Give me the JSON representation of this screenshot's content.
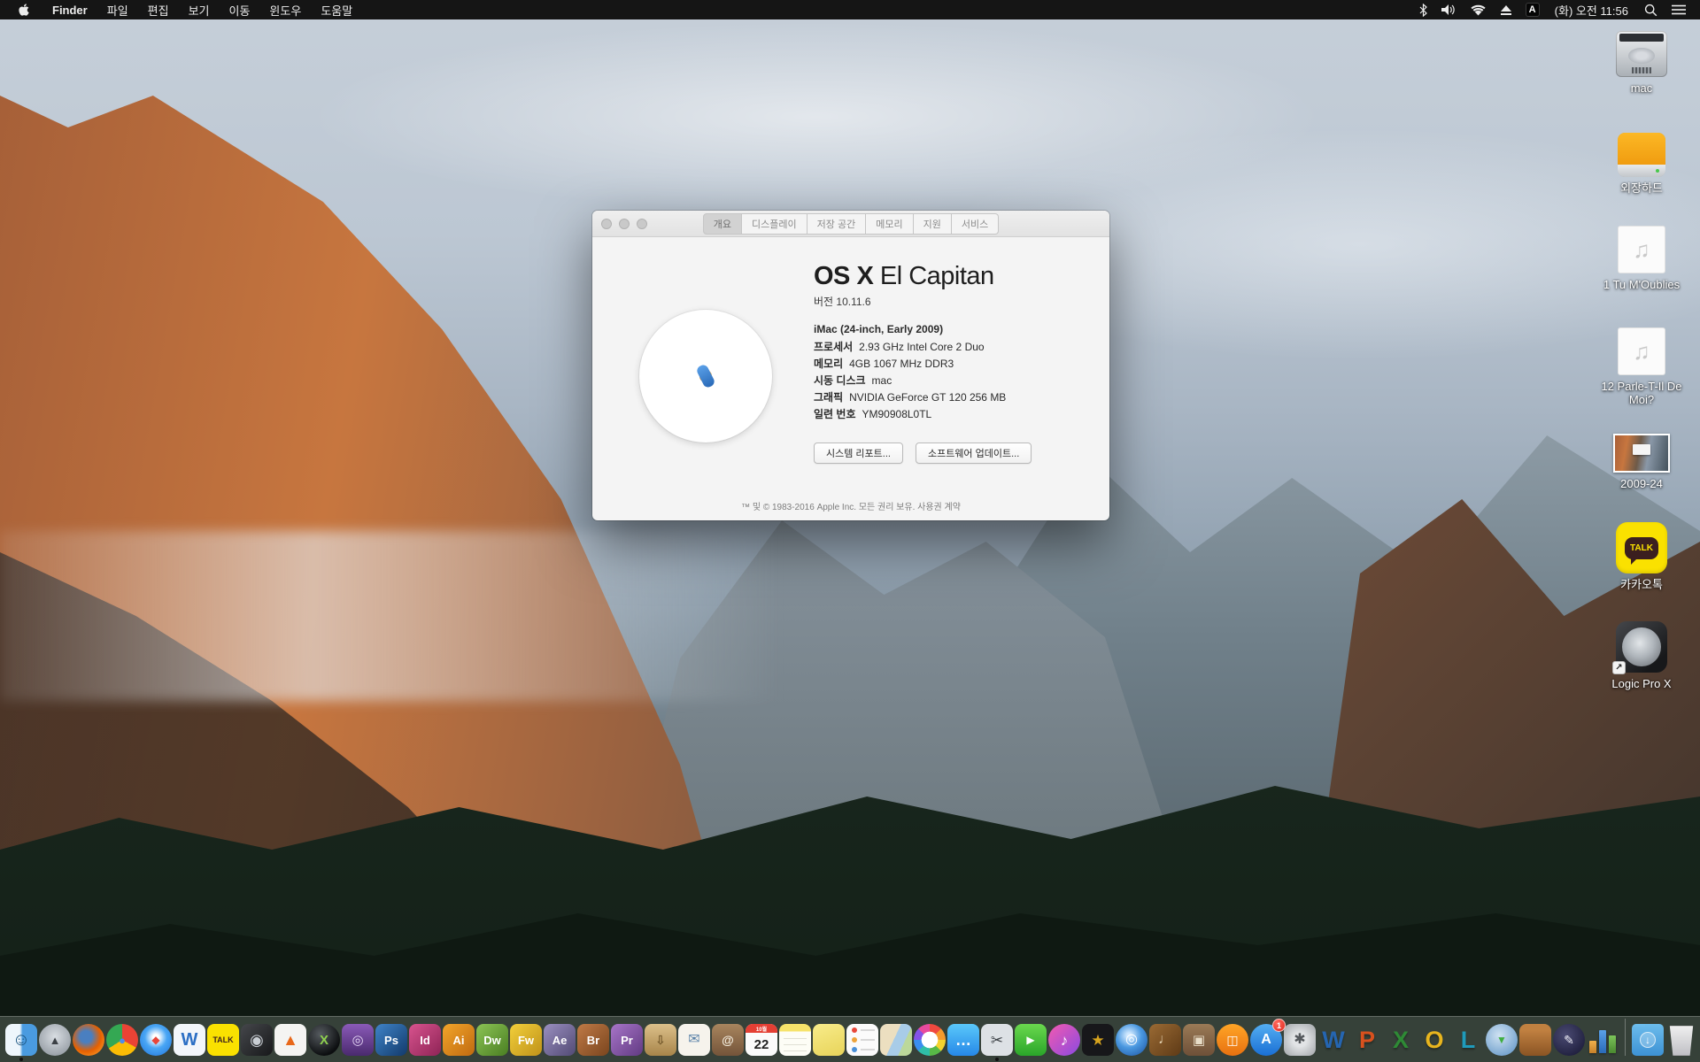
{
  "menu_bar": {
    "items": [
      "Finder",
      "파일",
      "편집",
      "보기",
      "이동",
      "윈도우",
      "도움말"
    ],
    "status": {
      "input_badge": "A",
      "clock": "(화) 오전 11:56"
    }
  },
  "window": {
    "tabs": [
      {
        "label": "개요",
        "selected": true
      },
      {
        "label": "디스플레이",
        "selected": false
      },
      {
        "label": "저장 공간",
        "selected": false
      },
      {
        "label": "메모리",
        "selected": false
      },
      {
        "label": "지원",
        "selected": false
      },
      {
        "label": "서비스",
        "selected": false
      }
    ],
    "title_os": "OS X",
    "title_name": "El Capitan",
    "version": "버전 10.11.6",
    "model": "iMac (24-inch, Early 2009)",
    "specs": [
      {
        "label": "프로세서",
        "value": "2.93 GHz Intel Core 2 Duo"
      },
      {
        "label": "메모리",
        "value": "4GB 1067 MHz DDR3"
      },
      {
        "label": "시동 디스크",
        "value": "mac"
      },
      {
        "label": "그래픽",
        "value": "NVIDIA GeForce GT 120 256 MB"
      },
      {
        "label": "일련 번호",
        "value": "YM90908L0TL"
      }
    ],
    "buttons": [
      "시스템 리포트...",
      "소프트웨어 업데이트..."
    ],
    "footer": "™ 및 © 1983-2016 Apple Inc. 모든 권리 보유. 사용권 계약"
  },
  "desktop_icons": [
    {
      "name": "mac-hdd",
      "label": "mac"
    },
    {
      "name": "external-hdd",
      "label": "외장하드"
    },
    {
      "name": "audio-file-1",
      "label": "1 Tu M'Oublies",
      "glyph": "♫"
    },
    {
      "name": "audio-file-2",
      "label": "12 Parle-T-Il De Moi?",
      "glyph": "♫"
    },
    {
      "name": "image-file",
      "label": "2009-24"
    },
    {
      "name": "kakaotalk",
      "label": "카카오톡",
      "bubble_text": "TALK"
    },
    {
      "name": "logic-pro-alias",
      "label": "Logic Pro X",
      "alias_arrow": "↗"
    }
  ],
  "dock": {
    "items": [
      {
        "name": "finder",
        "glyph": "☺",
        "fg": "#17527e",
        "fs": 20,
        "bg": "linear-gradient(90deg,#eef6fc 46%,#4a9be0 54%)",
        "running": true
      },
      {
        "name": "launchpad",
        "shape": "circle",
        "glyph": "▲",
        "fg": "#3c4146",
        "fs": 13,
        "bg": "radial-gradient(circle at 50% 40%,#d9dee3,#868e96)"
      },
      {
        "name": "firefox",
        "shape": "circle",
        "glyph": "",
        "bg": "radial-gradient(circle at 42% 40%,#4a7fc0 22%,#e66000 55%,#ffb13a)"
      },
      {
        "name": "chrome",
        "shape": "circle",
        "glyph": "●",
        "fg": "#4a8cf0",
        "fs": 13,
        "bg": "conic-gradient(#ea4335 0 33%,#fbbc05 33% 66%,#34a853 66% 100%)"
      },
      {
        "name": "safari",
        "shape": "circle",
        "glyph": "◆",
        "fg": "#e8453a",
        "fs": 12,
        "bg": "radial-gradient(circle at 50% 42%,#ffffff 12%,#49a6f5 45%,#1f72d8)"
      },
      {
        "name": "winebottler",
        "glyph": "W",
        "fg": "#2b6fc4",
        "fs": 20,
        "bold": true,
        "bg": "#f2f6fa"
      },
      {
        "name": "kakaotalk",
        "glyph": "TALK",
        "fg": "#3b1f1f",
        "fs": 9,
        "bold": true,
        "bg": "#fae100"
      },
      {
        "name": "logic-pro",
        "glyph": "◉",
        "fg": "#c9ced4",
        "fs": 18,
        "bg": "linear-gradient(135deg,#45474b,#17181a)"
      },
      {
        "name": "vlc",
        "glyph": "▲",
        "fg": "#e8681a",
        "fs": 18,
        "bg": "#f4f4f2"
      },
      {
        "name": "x-player",
        "shape": "circle",
        "glyph": "X",
        "fg": "#8fd14f",
        "fs": 15,
        "bold": true,
        "bg": "radial-gradient(circle at 38% 32%,#565b60,#0c0e10 72%)"
      },
      {
        "name": "toast-titanium",
        "glyph": "◎",
        "fg": "#e4d4f4",
        "fs": 15,
        "bg": "linear-gradient(180deg,#8a5ab8,#4a2a6e)"
      },
      {
        "name": "photoshop",
        "glyph": "Ps",
        "fg": "#ffffff",
        "fs": 13,
        "bold": true,
        "bg": "linear-gradient(135deg,#3f83c8,#123a6b)"
      },
      {
        "name": "indesign",
        "glyph": "Id",
        "fg": "#ffffff",
        "fs": 13,
        "bold": true,
        "bg": "linear-gradient(135deg,#d8538e,#8e2456)"
      },
      {
        "name": "illustrator",
        "glyph": "Ai",
        "fg": "#ffffff",
        "fs": 13,
        "bold": true,
        "bg": "linear-gradient(135deg,#f2a52a,#c06a10)"
      },
      {
        "name": "dreamweaver",
        "glyph": "Dw",
        "fg": "#ffffff",
        "fs": 13,
        "bold": true,
        "bg": "linear-gradient(135deg,#8cc455,#4a7e22)"
      },
      {
        "name": "fireworks",
        "glyph": "Fw",
        "fg": "#ffffff",
        "fs": 13,
        "bold": true,
        "bg": "linear-gradient(135deg,#f2cf3a,#bf921a)"
      },
      {
        "name": "after-effects",
        "glyph": "Ae",
        "fg": "#ffffff",
        "fs": 13,
        "bold": true,
        "bg": "linear-gradient(135deg,#9a8fc0,#524a74)"
      },
      {
        "name": "bridge",
        "glyph": "Br",
        "fg": "#ffffff",
        "fs": 13,
        "bold": true,
        "bg": "linear-gradient(135deg,#c07a46,#7a451e)"
      },
      {
        "name": "premiere",
        "glyph": "Pr",
        "fg": "#ffffff",
        "fs": 13,
        "bold": true,
        "bg": "linear-gradient(135deg,#a875c8,#613a82)"
      },
      {
        "name": "stuffit-expander",
        "glyph": "⇩",
        "fg": "#6e5428",
        "fs": 14,
        "bold": true,
        "bg": "linear-gradient(180deg,#dcc08a,#a8854a)"
      },
      {
        "name": "mail",
        "glyph": "✉",
        "fg": "#5a82a8",
        "fs": 16,
        "bg": "#f6f3ec"
      },
      {
        "name": "contacts",
        "glyph": "@",
        "fg": "#f0e8d8",
        "fs": 14,
        "bold": true,
        "bg": "linear-gradient(180deg,#a8855e,#74543a)"
      },
      {
        "name": "calendar",
        "kind": "calendar",
        "month": "10월",
        "day": "22"
      },
      {
        "name": "notes",
        "kind": "notes"
      },
      {
        "name": "stickies",
        "glyph": "",
        "bg": "linear-gradient(160deg,#f8ec8a,#e8d45a)"
      },
      {
        "name": "reminders",
        "kind": "reminders"
      },
      {
        "name": "maps",
        "glyph": "",
        "bg": "linear-gradient(115deg,#ecdfc0 45%,#a8cce8 45% 70%,#bcd89a 70%)"
      },
      {
        "name": "photos",
        "kind": "photos",
        "shape": "circle"
      },
      {
        "name": "messages",
        "glyph": "…",
        "fg": "#ffffff",
        "fs": 18,
        "bold": true,
        "bg": "linear-gradient(180deg,#5ac8fa,#2688e8)"
      },
      {
        "name": "grab-screenshot",
        "glyph": "✂",
        "fg": "#3a3f44",
        "fs": 17,
        "bg": "#dde1e5",
        "running": true
      },
      {
        "name": "facetime",
        "glyph": "▶",
        "fg": "#ffffff",
        "fs": 12,
        "bg": "linear-gradient(180deg,#6ad84e,#2aa62a)"
      },
      {
        "name": "itunes",
        "shape": "circle",
        "glyph": "♪",
        "fg": "#ffffff",
        "fs": 17,
        "bg": "linear-gradient(135deg,#f35ab0,#8a4ae0)"
      },
      {
        "name": "imovie",
        "glyph": "★",
        "fg": "#d8a41e",
        "fs": 17,
        "bg": "#17171a"
      },
      {
        "name": "idvd",
        "shape": "circle",
        "glyph": "◎",
        "fg": "#ffffff",
        "fs": 16,
        "bg": "radial-gradient(circle at 42% 36%,#cfe8ff 8%,#4a98e0 45%,#1a4f9e)"
      },
      {
        "name": "garageband",
        "glyph": "♩",
        "fg": "#e8d8b8",
        "fs": 16,
        "bg": "linear-gradient(135deg,#9a6a34,#5e3a16)"
      },
      {
        "name": "photo-collage",
        "glyph": "▣",
        "fg": "#e8ddc8",
        "fs": 15,
        "bg": "linear-gradient(180deg,#9a7a56,#6e5038)"
      },
      {
        "name": "ibooks",
        "shape": "circle",
        "glyph": "◫",
        "fg": "#ffffff",
        "fs": 14,
        "bg": "linear-gradient(180deg,#ffa526,#e87110)"
      },
      {
        "name": "app-store",
        "shape": "circle",
        "glyph": "A",
        "fg": "#ffffff",
        "fs": 16,
        "bold": true,
        "bg": "linear-gradient(180deg,#54aef2,#1a6fd4)",
        "badge": "1"
      },
      {
        "name": "system-preferences",
        "glyph": "✱",
        "fg": "#54585c",
        "fs": 16,
        "bg": "radial-gradient(circle,#e2e4e6 30%,#a0a4a8)"
      },
      {
        "name": "ms-word",
        "kind": "letter",
        "glyph": "W",
        "fg": "#2565b0"
      },
      {
        "name": "ms-powerpoint",
        "kind": "letter",
        "glyph": "P",
        "fg": "#d8511e"
      },
      {
        "name": "ms-excel",
        "kind": "letter",
        "glyph": "X",
        "fg": "#2e8a35"
      },
      {
        "name": "ms-outlook",
        "kind": "letter",
        "glyph": "O",
        "fg": "#e8b51e"
      },
      {
        "name": "ms-lync",
        "kind": "letter",
        "glyph": "L",
        "fg": "#1f9aba"
      },
      {
        "name": "web-downloader",
        "shape": "circle",
        "glyph": "▼",
        "fg": "#3fae3f",
        "fs": 12,
        "bold": true,
        "bg": "radial-gradient(circle at 42% 36%,#cfe2f2,#5a90c4)"
      },
      {
        "name": "keynote",
        "glyph": "",
        "bg": "linear-gradient(180deg,#c08040 20%,#8a5424)"
      },
      {
        "name": "pages",
        "shape": "circle",
        "glyph": "✎",
        "fg": "#f0f0f8",
        "fs": 14,
        "bg": "radial-gradient(circle at 40% 35%,#4a4a72,#141430)"
      },
      {
        "name": "numbers",
        "kind": "numbers"
      },
      {
        "separator": true
      },
      {
        "name": "downloads-folder",
        "kind": "folder"
      },
      {
        "name": "trash",
        "kind": "trash"
      }
    ]
  }
}
